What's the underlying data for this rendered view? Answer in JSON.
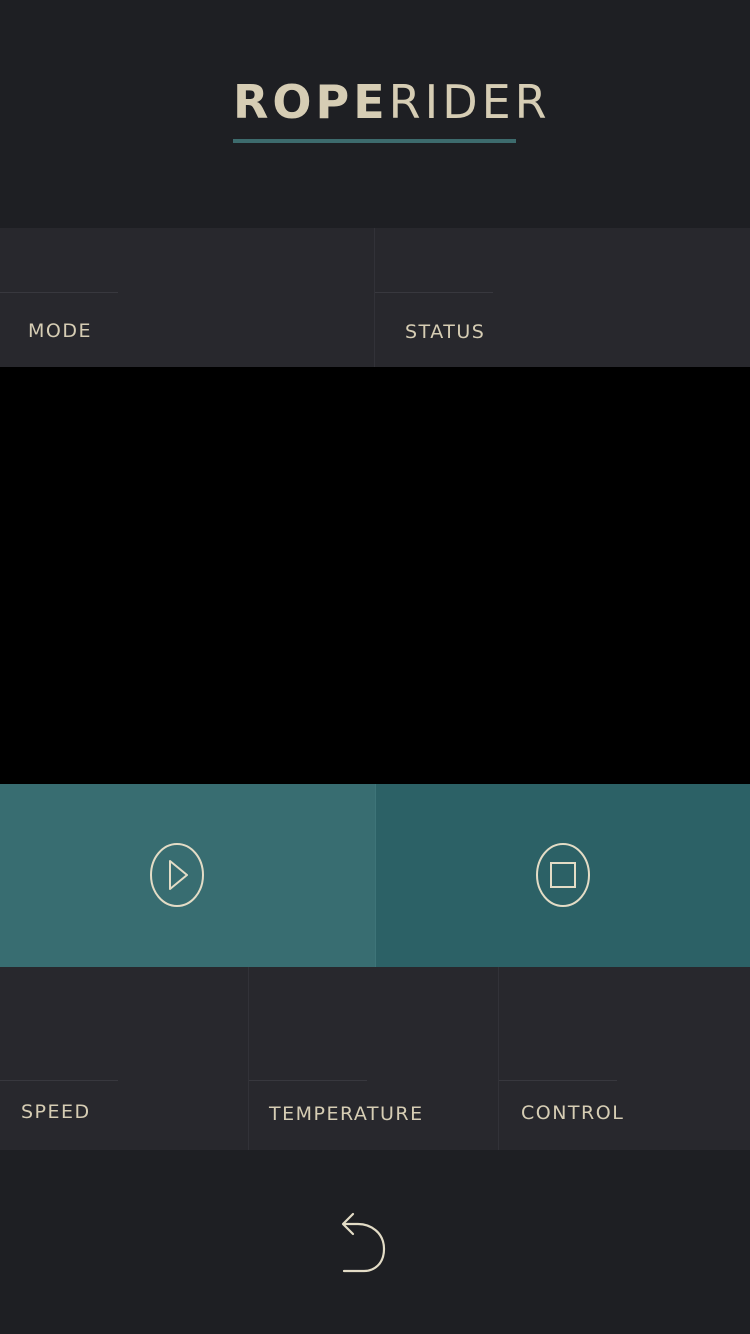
{
  "header": {
    "logo_bold": "ROPE",
    "logo_light": "RIDER",
    "accent_color": "#3d6b6d"
  },
  "info_top": [
    {
      "label": "MODE"
    },
    {
      "label": "STATUS"
    }
  ],
  "controls": {
    "play_icon": "play-icon",
    "stop_icon": "stop-icon",
    "play_color": "#386d71",
    "stop_color": "#2c6166"
  },
  "info_bottom": [
    {
      "label": "SPEED"
    },
    {
      "label": "TEMPERATURE"
    },
    {
      "label": "CONTROL"
    }
  ],
  "footer": {
    "back_icon": "back-arrow-icon"
  },
  "colors": {
    "background": "#1e1f23",
    "panel": "#28282d",
    "text": "#d6cdb4"
  }
}
